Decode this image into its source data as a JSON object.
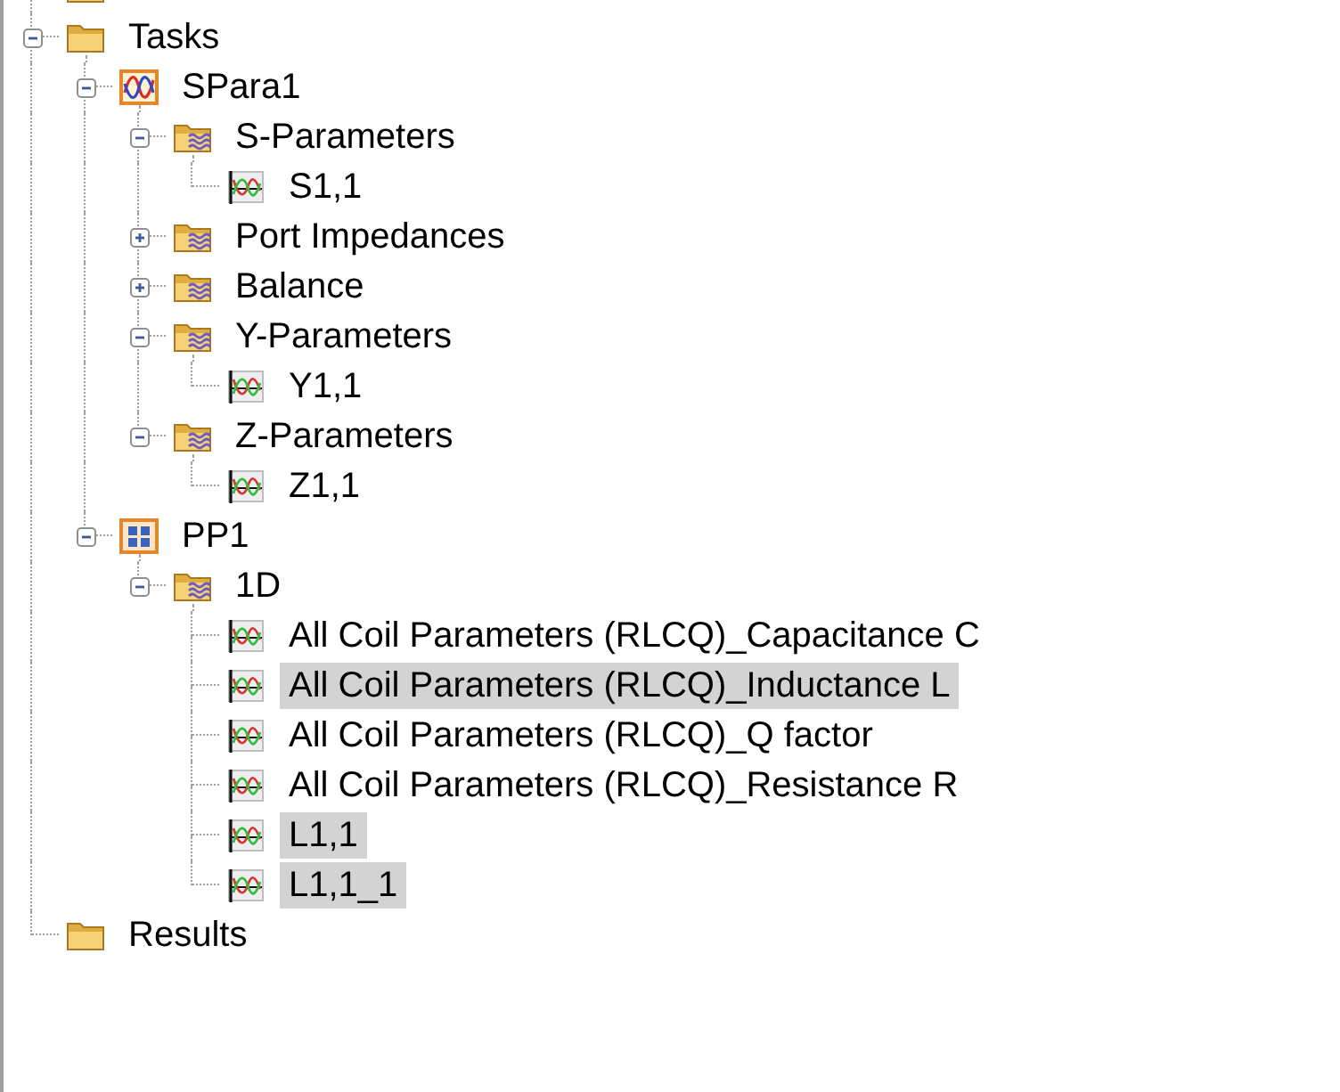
{
  "tree": [
    {
      "kind": "folder"
    },
    {
      "label": "Tasks",
      "kind": "folder",
      "expanded": true,
      "selected": false,
      "children": [
        {
          "label": "SPara1",
          "kind": "sparam",
          "expanded": true,
          "selected": false,
          "children": [
            {
              "label": "S-Parameters",
              "kind": "group",
              "expanded": true,
              "selected": false,
              "children": [
                {
                  "label": "S1,1",
                  "kind": "curve",
                  "selected": false
                }
              ]
            },
            {
              "label": "Port Impedances",
              "kind": "group",
              "expanded": false,
              "selected": false
            },
            {
              "label": "Balance",
              "kind": "group",
              "expanded": false,
              "selected": false
            },
            {
              "label": "Y-Parameters",
              "kind": "group",
              "expanded": true,
              "selected": false,
              "children": [
                {
                  "label": "Y1,1",
                  "kind": "curve",
                  "selected": false
                }
              ]
            },
            {
              "label": "Z-Parameters",
              "kind": "group",
              "expanded": true,
              "selected": false,
              "children": [
                {
                  "label": "Z1,1",
                  "kind": "curve",
                  "selected": false
                }
              ]
            }
          ]
        },
        {
          "label": "PP1",
          "kind": "postprocess",
          "expanded": true,
          "selected": false,
          "children": [
            {
              "label": "1D",
              "kind": "group",
              "expanded": true,
              "selected": false,
              "children": [
                {
                  "label": "All Coil Parameters (RLCQ)_Capacitance C",
                  "kind": "curve",
                  "selected": false
                },
                {
                  "label": "All Coil Parameters (RLCQ)_Inductance L",
                  "kind": "curve",
                  "selected": true
                },
                {
                  "label": "All Coil Parameters (RLCQ)_Q factor",
                  "kind": "curve",
                  "selected": false
                },
                {
                  "label": "All Coil Parameters (RLCQ)_Resistance R",
                  "kind": "curve",
                  "selected": false
                },
                {
                  "label": "L1,1",
                  "kind": "curve",
                  "selected": true
                },
                {
                  "label": "L1,1_1",
                  "kind": "curve",
                  "selected": true
                }
              ]
            }
          ]
        }
      ]
    },
    {
      "label": "Results",
      "kind": "folder",
      "selected": false
    }
  ]
}
